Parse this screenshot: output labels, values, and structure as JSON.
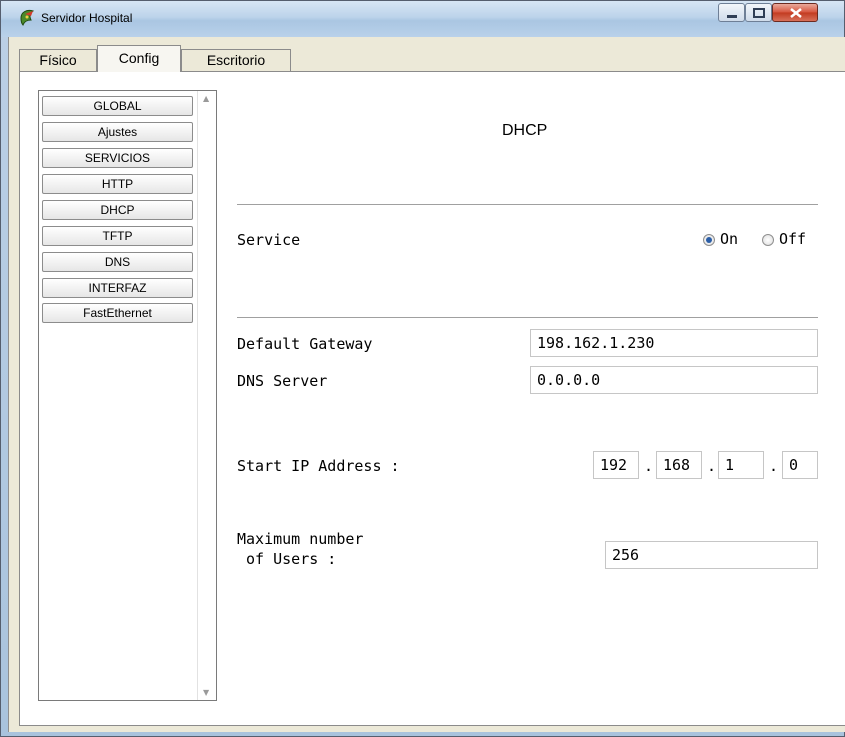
{
  "window": {
    "title": "Servidor Hospital",
    "controls": {
      "minimize": "minimize-icon",
      "maximize": "maximize-icon",
      "close": "close-icon"
    }
  },
  "tabs": [
    "Físico",
    "Config",
    "Escritorio"
  ],
  "active_tab": "Config",
  "sidebar": {
    "items": [
      "GLOBAL",
      "Ajustes",
      "SERVICIOS",
      "HTTP",
      "DHCP",
      "TFTP",
      "DNS",
      "INTERFAZ",
      "FastEthernet"
    ]
  },
  "dhcp": {
    "title": "DHCP",
    "service_label": "Service",
    "service_on": "On",
    "service_off": "Off",
    "service_selected": "On",
    "gateway_label": "Default Gateway",
    "gateway_value": "198.162.1.230",
    "dns_label": "DNS Server",
    "dns_value": "0.0.0.0",
    "start_ip_label": "Start IP Address :",
    "start_ip": [
      "192",
      "168",
      "1",
      "0"
    ],
    "max_users_label_1": "Maximum number",
    "max_users_label_2": " of Users :",
    "max_users_value": "256"
  },
  "colors": {
    "radio_selected": "#2b5ea7",
    "close_button": "#c23a1f"
  }
}
